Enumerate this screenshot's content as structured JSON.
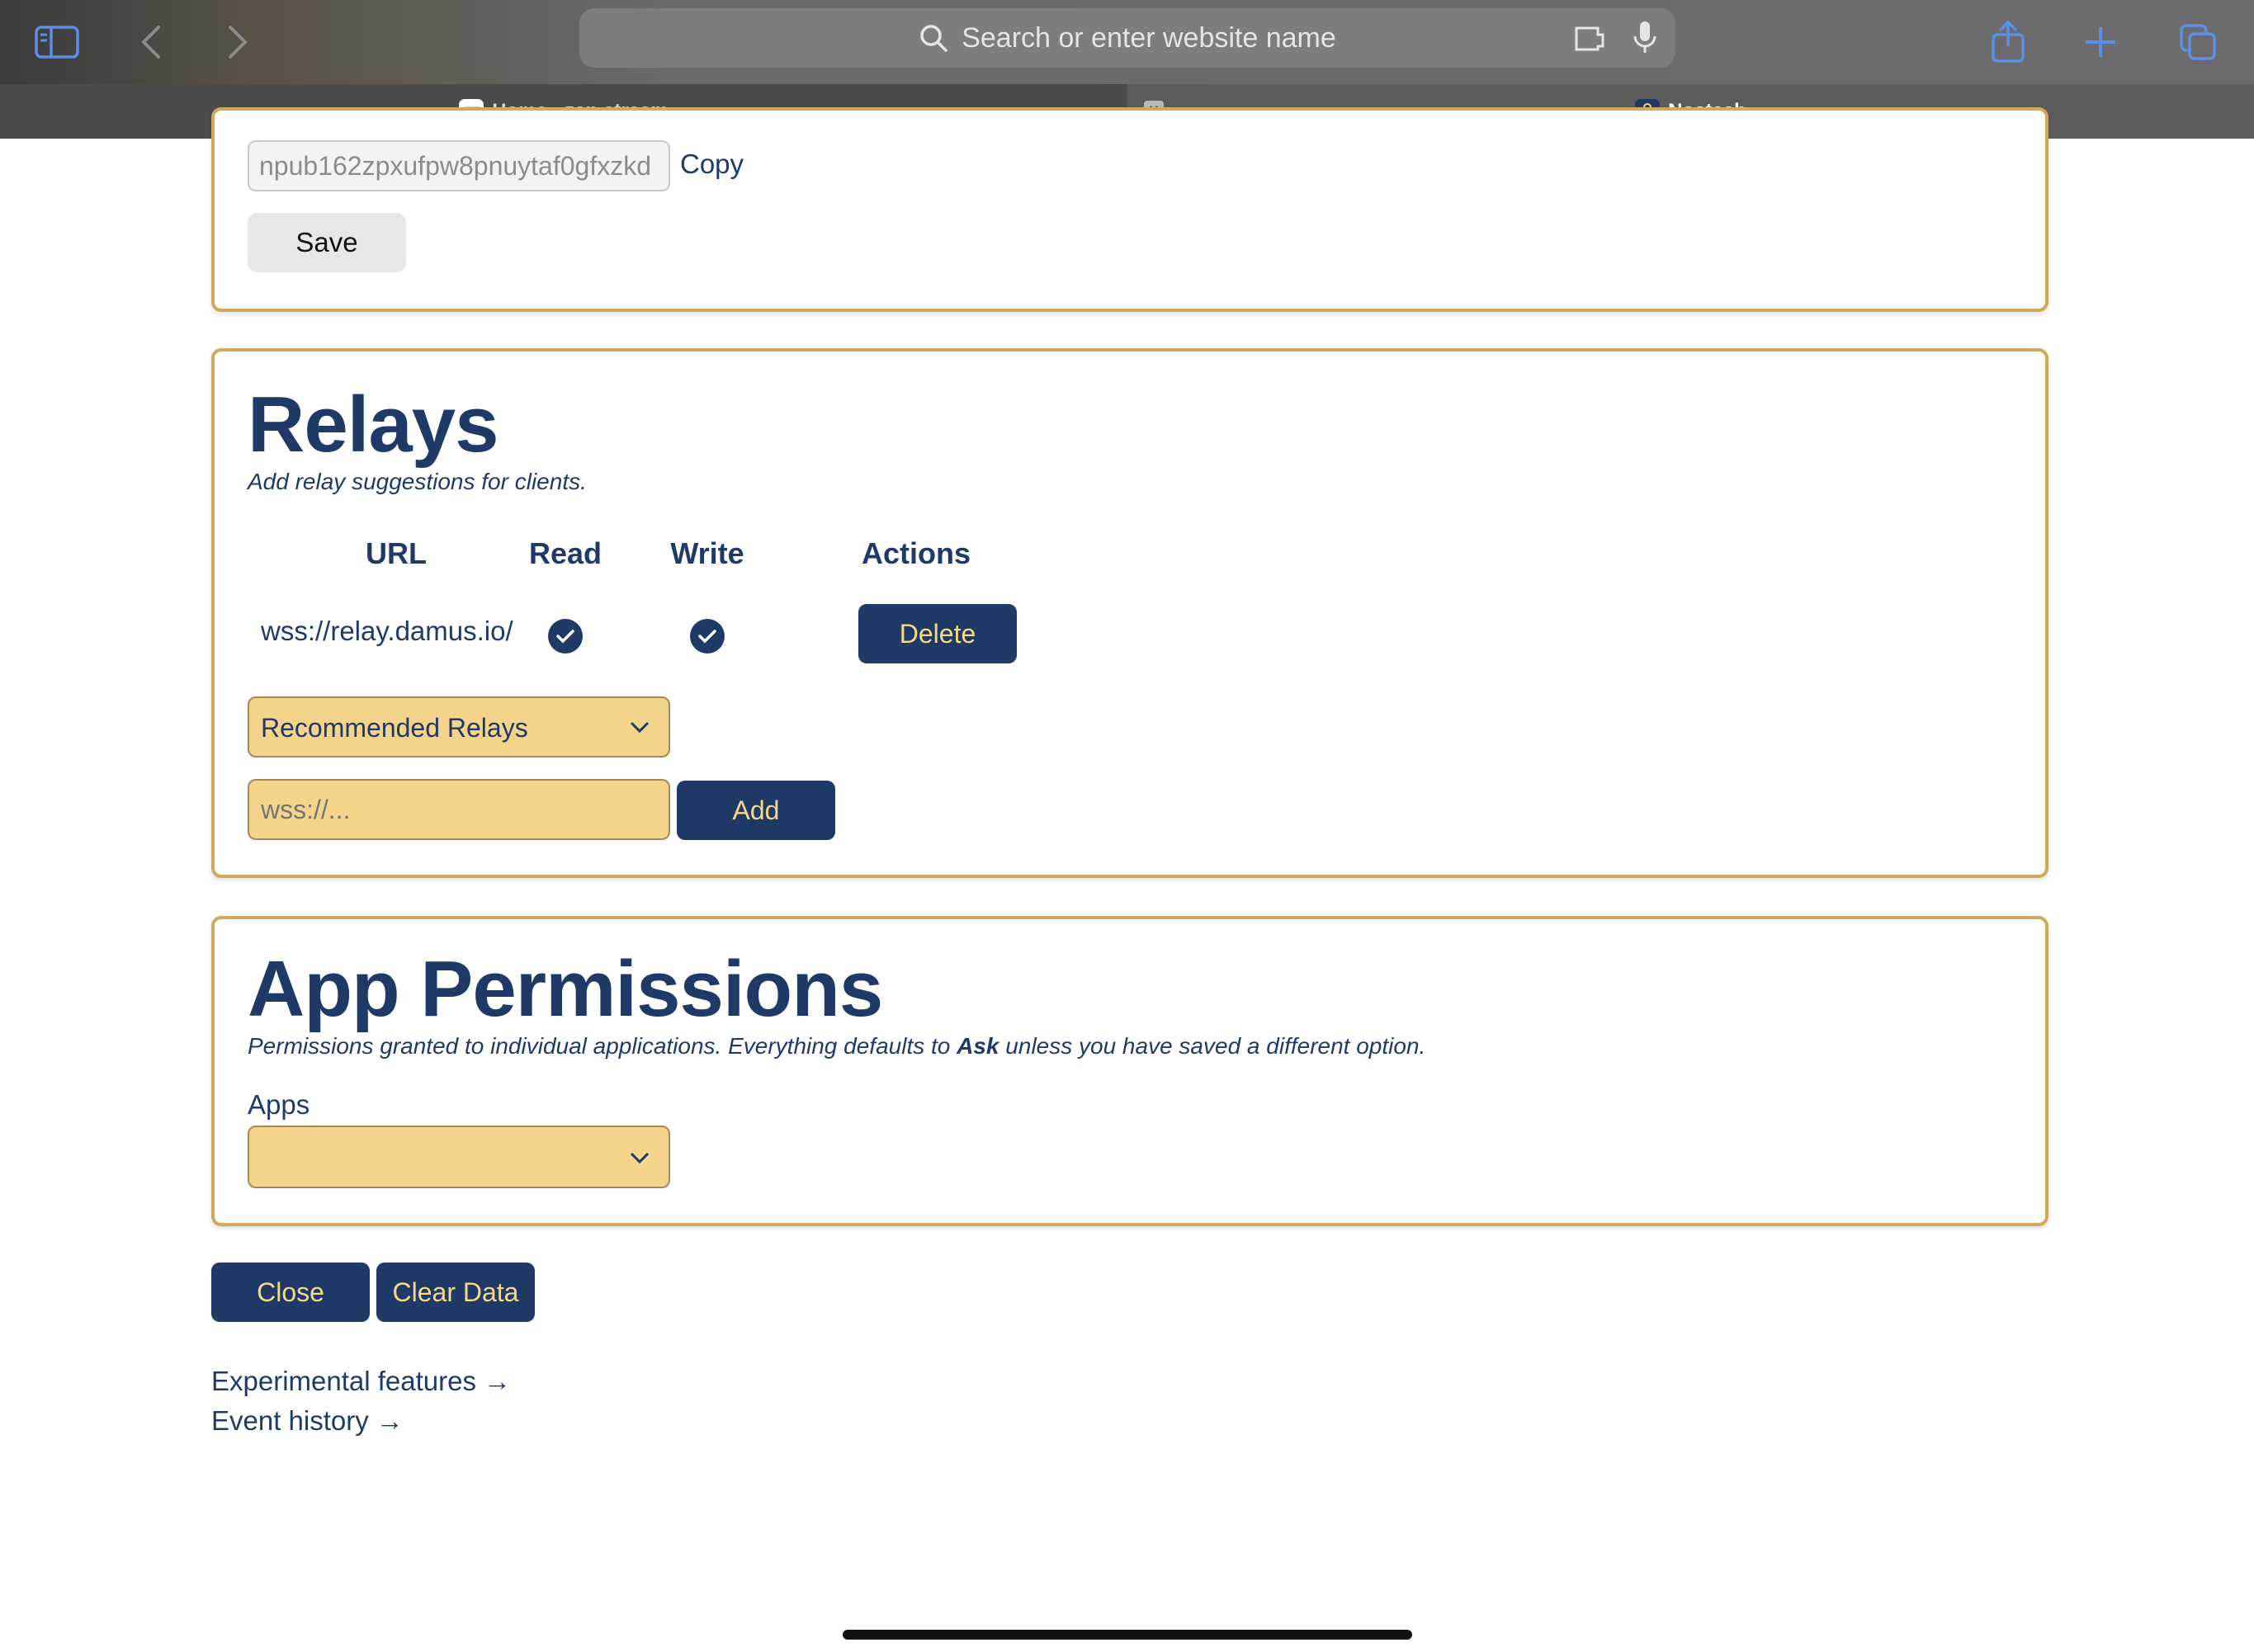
{
  "browser": {
    "address_placeholder": "Search or enter website name",
    "tabs": [
      {
        "label": "Home - zap.stream"
      },
      {
        "label": "Nostash"
      }
    ]
  },
  "profile": {
    "npub_value": "npub162zpxufpw8pnuytaf0gfxzkd",
    "copy_label": "Copy",
    "save_label": "Save"
  },
  "relays": {
    "title": "Relays",
    "subtitle": "Add relay suggestions for clients.",
    "columns": [
      "URL",
      "Read",
      "Write",
      "Actions"
    ],
    "rows": [
      {
        "url": "wss://relay.damus.io/",
        "read": true,
        "write": true,
        "action": "Delete"
      }
    ],
    "recommended_select": "Recommended Relays",
    "new_relay_placeholder": "wss://...",
    "add_label": "Add"
  },
  "permissions": {
    "title": "App Permissions",
    "subtitle_pre": "Permissions granted to individual applications. Everything defaults to ",
    "subtitle_bold": "Ask",
    "subtitle_post": " unless you have saved a different option.",
    "apps_label": "Apps",
    "apps_selected": ""
  },
  "footer": {
    "close_label": "Close",
    "clear_label": "Clear Data",
    "links": [
      "Experimental features →",
      "Event history →"
    ]
  },
  "colors": {
    "navy": "#1f3a66",
    "gold_border": "#d2a95a",
    "field_yellow": "#f4d48a",
    "button_text": "#f4d98b"
  }
}
